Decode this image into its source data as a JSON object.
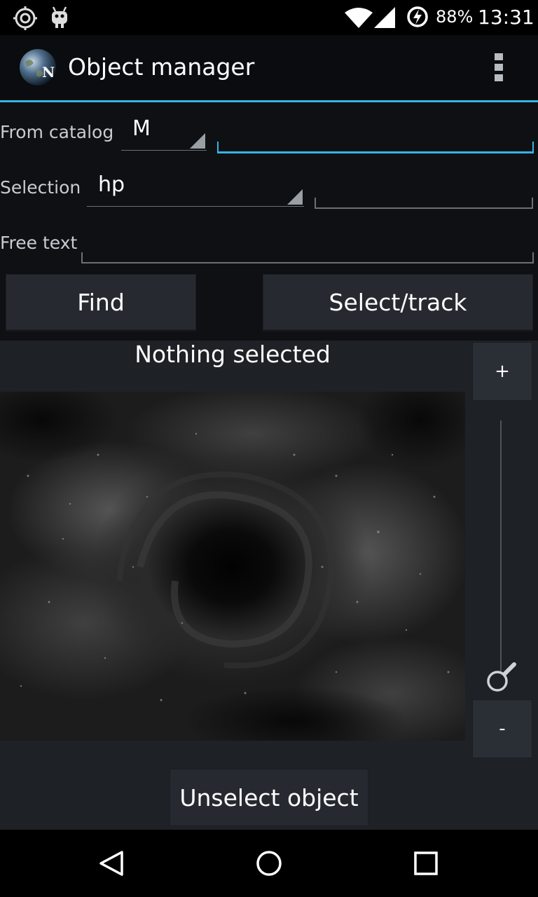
{
  "status_bar": {
    "battery_percent": "88%",
    "time": "13:31",
    "icons": [
      "target-icon",
      "android-bug-icon",
      "wifi-icon",
      "cell-signal-icon",
      "battery-charging-icon"
    ]
  },
  "action_bar": {
    "title": "Object manager",
    "logo_icon": "earth-compass-logo",
    "overflow_icon": "overflow-menu-icon"
  },
  "form": {
    "catalog_label": "From catalog",
    "catalog_value": "M",
    "catalog_input_value": "",
    "selection_label": "Selection",
    "selection_value": "hp",
    "selection_input_value": "",
    "free_text_label": "Free text",
    "free_text_value": ""
  },
  "buttons": {
    "find": "Find",
    "select_track": "Select/track",
    "unselect": "Unselect object"
  },
  "panel": {
    "status": "Nothing selected",
    "zoom_in": "+",
    "zoom_out": "-"
  },
  "colors": {
    "accent": "#33b5e5",
    "background": "#0e1014",
    "panel": "#1e2126",
    "button": "#262a30"
  },
  "nav_bar": {
    "icons": [
      "back-icon",
      "home-icon",
      "recents-icon"
    ]
  }
}
